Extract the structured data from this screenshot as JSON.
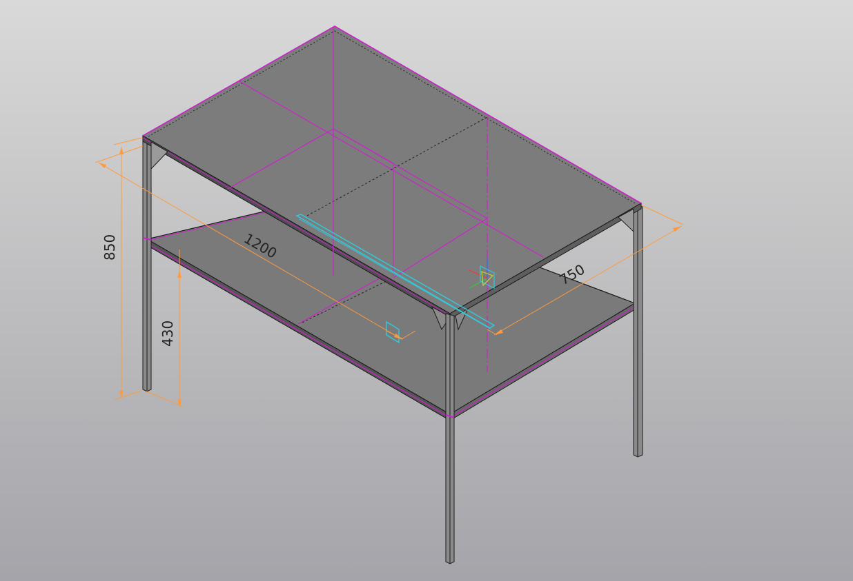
{
  "view": {
    "background_top": "#d9d9d9",
    "background_bottom": "#a4a4aa"
  },
  "colors": {
    "surface": "#7b7b7b",
    "surface_dark": "#6e6e6e",
    "edge": "#1a1a1a",
    "axis_line": "#cc22cc",
    "dimension": "#ff9a3c",
    "selection": "#33c8d8",
    "axis_x": "#ff3333",
    "axis_y": "#33cc33",
    "axis_z": "#3366ff"
  },
  "dimensions": {
    "height_total": "850",
    "height_shelf": "430",
    "length": "1200",
    "width": "750"
  }
}
